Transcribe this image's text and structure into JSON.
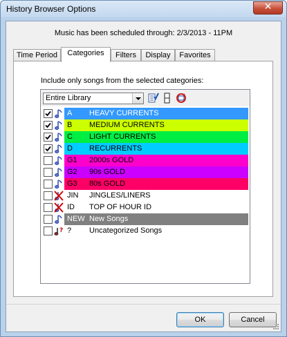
{
  "window": {
    "title": "History Browser Options",
    "close_glyph": "✕"
  },
  "schedule_text": "Music has been scheduled through: 2/3/2013 - 11PM",
  "tabs": [
    {
      "label": "Time Period",
      "active": false
    },
    {
      "label": "Categories",
      "active": true
    },
    {
      "label": "Filters",
      "active": false
    },
    {
      "label": "Display",
      "active": false
    },
    {
      "label": "Favorites",
      "active": false
    }
  ],
  "instruction": "Include only songs from the selected categories:",
  "library_select": {
    "value": "Entire Library"
  },
  "toolbar_icons": [
    "check-all-icon",
    "column-icon",
    "refresh-icon"
  ],
  "categories": [
    {
      "checked": true,
      "icon": "music-note-icon",
      "code": "A",
      "name": "HEAVY CURRENTS",
      "color": "#3399ff",
      "text_color": "#ffffff"
    },
    {
      "checked": true,
      "icon": "music-note-icon",
      "code": "B",
      "name": "MEDIUM CURRENTS",
      "color": "#ccff00",
      "text_color": "#000000"
    },
    {
      "checked": true,
      "icon": "music-note-icon",
      "code": "C",
      "name": "LIGHT CURRENTS",
      "color": "#00ee44",
      "text_color": "#000000"
    },
    {
      "checked": true,
      "icon": "music-note-icon",
      "code": "D",
      "name": "RECURRENTS",
      "color": "#00ccff",
      "text_color": "#000000"
    },
    {
      "checked": false,
      "icon": "music-note-icon",
      "code": "G1",
      "name": "2000s GOLD",
      "color": "#ff00cc",
      "text_color": "#000000"
    },
    {
      "checked": false,
      "icon": "music-note-icon",
      "code": "G2",
      "name": "90s GOLD",
      "color": "#cc00ff",
      "text_color": "#000000"
    },
    {
      "checked": false,
      "icon": "music-note-icon",
      "code": "G3",
      "name": "80s GOLD",
      "color": "#ff0066",
      "text_color": "#000000"
    },
    {
      "checked": false,
      "icon": "no-music-icon",
      "code": "JIN",
      "name": "JINGLES/LINERS",
      "color": "#ffffff",
      "text_color": "#000000"
    },
    {
      "checked": false,
      "icon": "no-music-icon",
      "code": "ID",
      "name": "TOP OF HOUR ID",
      "color": "#ffffff",
      "text_color": "#000000"
    },
    {
      "checked": false,
      "icon": "music-note-icon",
      "code": "NEW",
      "name": "New Songs",
      "color": "#808080",
      "text_color": "#ffffff"
    },
    {
      "checked": false,
      "icon": "question-note-icon",
      "code": "?",
      "name": "Uncategorized Songs",
      "color": "#ffffff",
      "text_color": "#000000"
    }
  ],
  "buttons": {
    "ok": "OK",
    "cancel": "Cancel"
  }
}
